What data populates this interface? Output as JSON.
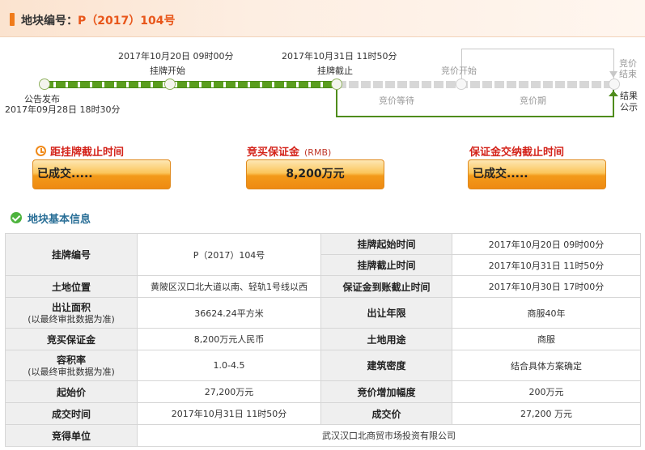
{
  "header": {
    "title_prefix": "地块编号：",
    "code": "P（2017）104号"
  },
  "timeline": {
    "publish_label": "公告发布",
    "publish_time": "2017年09月28日  18时30分",
    "listing_start_time": "2017年10月20日  09时00分",
    "listing_start_label": "挂牌开始",
    "listing_end_time": "2017年10月31日  11时50分",
    "listing_end_label": "挂牌截止",
    "bid_start_label": "竞价开始",
    "bid_waiting_label": "竞价等待",
    "bid_period_label": "竞价期",
    "bid_end_label_1": "竞价",
    "bid_end_label_2": "结束",
    "result_label_1": "结果",
    "result_label_2": "公示",
    "colors": {
      "done": "#5a9e1e",
      "pending": "#d7d7d7"
    }
  },
  "boxes": {
    "countdown": {
      "label": "距挂牌截止时间",
      "value": "已成交....."
    },
    "deposit": {
      "label": "竞买保证金",
      "unit": "(RMB)",
      "value": "8,200万元"
    },
    "deposit_deadline": {
      "label": "保证金交纳截止时间",
      "value": "已成交....."
    }
  },
  "section": {
    "title": "地块基本信息"
  },
  "table": {
    "listing_no_label": "挂牌编号",
    "listing_no": "P（2017）104号",
    "listing_start_label": "挂牌起始时间",
    "listing_start": "2017年10月20日 09时00分",
    "listing_end_label": "挂牌截止时间",
    "listing_end": "2017年10月31日 11时50分",
    "location_label": "土地位置",
    "location": "黄陂区汉口北大道以南、轻轨1号线以西",
    "deposit_deadline_label": "保证金到账截止时间",
    "deposit_deadline": "2017年10月30日 17时00分",
    "area_label": "出让面积",
    "area_sub": "(以最终审批数据为准)",
    "area": "36624.24平方米",
    "term_label": "出让年限",
    "term": "商服40年",
    "deposit_label": "竞买保证金",
    "deposit": "8,200万元人民币",
    "usage_label": "土地用途",
    "usage": "商服",
    "far_label": "容积率",
    "far_sub": "(以最终审批数据为准)",
    "far": "1.0-4.5",
    "density_label": "建筑密度",
    "density": "结合具体方案确定",
    "start_price_label": "起始价",
    "start_price": "27,200万元",
    "increment_label": "竞价增加幅度",
    "increment": "200万元",
    "deal_time_label": "成交时间",
    "deal_time": "2017年10月31日 11时50分",
    "deal_price_label": "成交价",
    "deal_price": "27,200 万元",
    "winner_label": "竞得单位",
    "winner": "武汉汉口北商贸市场投资有限公司"
  }
}
